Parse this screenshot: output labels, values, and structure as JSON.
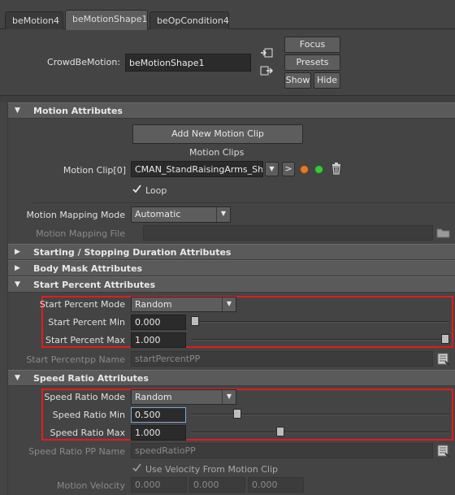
{
  "tabs": [
    "beMotion4",
    "beMotionShape1",
    "beOpCondition4"
  ],
  "node": {
    "label": "CrowdBeMotion:",
    "value": "beMotionShape1"
  },
  "buttons": {
    "focus": "Focus",
    "presets": "Presets",
    "show": "Show",
    "hide": "Hide"
  },
  "motion": {
    "header": "Motion Attributes",
    "add_clip": "Add New Motion Clip",
    "clips_label": "Motion Clips",
    "clip_label": "Motion Clip[0]",
    "clip_value": "CMAN_StandRaisingArms_Shape",
    "goto_button": ">",
    "loop_label": "Loop",
    "loop_checked": true,
    "mapping_mode_label": "Motion Mapping Mode",
    "mapping_mode_value": "Automatic",
    "mapping_file_label": "Motion Mapping File",
    "mapping_file_value": ""
  },
  "collapsed_sections": [
    "Starting / Stopping Duration Attributes",
    "Body Mask Attributes"
  ],
  "start_percent": {
    "header": "Start Percent Attributes",
    "mode_label": "Start Percent Mode",
    "mode_value": "Random",
    "min_label": "Start Percent Min",
    "min_value": "0.000",
    "min_fraction": 0.0,
    "max_label": "Start Percent Max",
    "max_value": "1.000",
    "max_fraction": 1.0,
    "pp_label": "Start Percentpp Name",
    "pp_value": "startPercentPP"
  },
  "speed_ratio": {
    "header": "Speed Ratio Attributes",
    "mode_label": "Speed Ratio Mode",
    "mode_value": "Random",
    "min_label": "Speed Ratio Min",
    "min_value": "0.500",
    "min_fraction": 0.17,
    "max_label": "Speed Ratio Max",
    "max_value": "1.000",
    "max_fraction": 0.34,
    "pp_label": "Speed Ratio PP Name",
    "pp_value": "speedRatioPP",
    "velocity_checkbox_label": "Use Velocity From Motion Clip",
    "velocity_checked": true,
    "motion_velocity_label": "Motion Velocity",
    "motion_velocity_values": [
      "0.000",
      "0.000",
      "0.000"
    ]
  },
  "colors": {
    "highlight": "#e31b1b",
    "orange_dot": "#e07a2a",
    "green_dot": "#3ec43e"
  },
  "icons": [
    "node-in-icon",
    "node-out-icon",
    "orange-circle-icon",
    "green-circle-icon",
    "trash-icon",
    "folder-icon",
    "list-icon",
    "checkbox-icon"
  ]
}
